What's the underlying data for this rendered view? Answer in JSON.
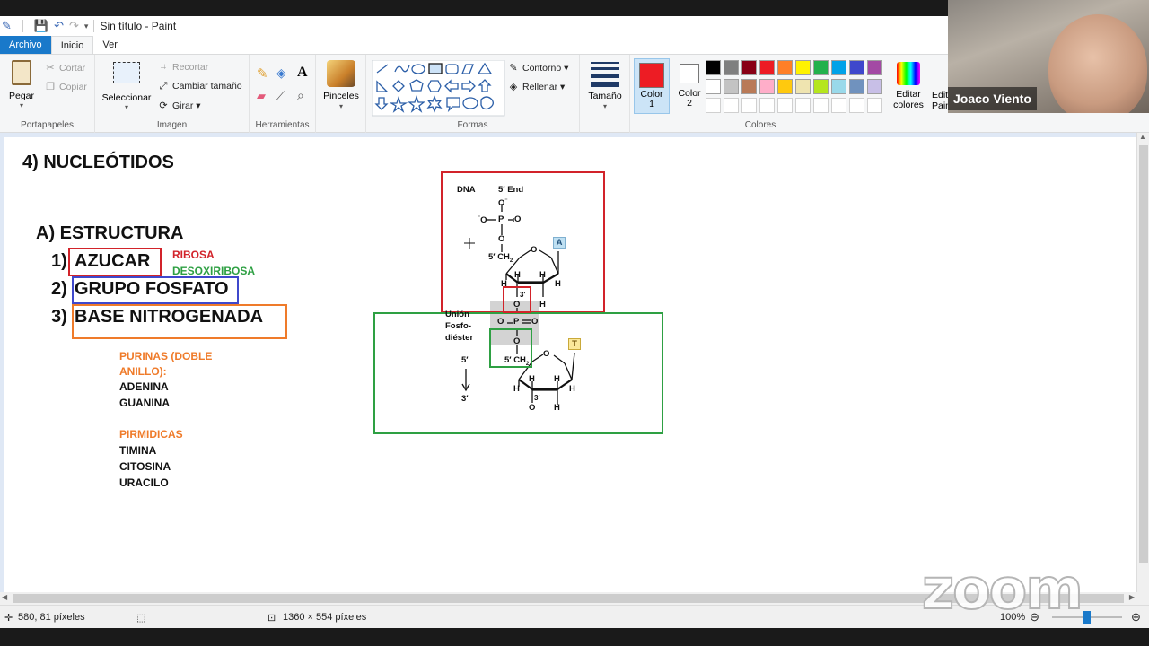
{
  "app": {
    "title": "Sin título - Paint"
  },
  "ribbon_tabs": [
    "Archivo",
    "Inicio",
    "Ver"
  ],
  "groups": {
    "portapapeles": {
      "label": "Portapapeles",
      "paste": "Pegar",
      "cut": "Cortar",
      "copy": "Copiar"
    },
    "imagen": {
      "label": "Imagen",
      "select": "Seleccionar",
      "crop": "Recortar",
      "resize": "Cambiar tamaño",
      "rotate": "Girar"
    },
    "herramientas": {
      "label": "Herramientas"
    },
    "pinceles": {
      "label": "Pinceles"
    },
    "formas": {
      "label": "Formas",
      "outline": "Contorno",
      "fill": "Rellenar"
    },
    "tamano": {
      "label": "Tamaño"
    },
    "colores": {
      "label": "Colores",
      "color1": "Color 1",
      "color2": "Color 2",
      "edit": "Editar colores",
      "edit3d": "Editar con Paint 3D",
      "color1_value": "#ed1c24",
      "color2_value": "#ffffff",
      "palette_row1": [
        "#000000",
        "#7f7f7f",
        "#880015",
        "#ed1c24",
        "#ff7f27",
        "#fff200",
        "#22b14c",
        "#00a2e8",
        "#3f48cc",
        "#a349a4"
      ],
      "palette_row2": [
        "#ffffff",
        "#c3c3c3",
        "#b97a57",
        "#ffaec9",
        "#ffc90e",
        "#efe4b0",
        "#b5e61d",
        "#99d9ea",
        "#7092be",
        "#c8bfe7"
      ]
    }
  },
  "canvas": {
    "heading": "4) NUCLEÓTIDOS",
    "subheading": "A) ESTRUCTURA",
    "items": [
      {
        "num": "1)",
        "text": "AZUCAR"
      },
      {
        "num": "2)",
        "text": "GRUPO FOSFATO"
      },
      {
        "num": "3)",
        "text": "BASE NITROGENADA"
      }
    ],
    "sugar_types": {
      "ribosa": "RIBOSA",
      "desoxiribosa": "DESOXIRIBOSA"
    },
    "purinas_title": "PURINAS (DOBLE ANILLO):",
    "purinas": [
      "ADENINA",
      "GUANINA"
    ],
    "pirimidicas_title": "PIRMIDICAS",
    "pirimidicas": [
      "TIMINA",
      "CITOSINA",
      "URACILO"
    ],
    "diagram": {
      "dna": "DNA",
      "end5": "5′ End",
      "union": "Unión",
      "fosfo": "Fosfo-",
      "diester": "diéster",
      "base_a": "A",
      "base_t": "T",
      "dir_5": "5′",
      "dir_3": "3′"
    }
  },
  "status": {
    "coords": "580, 81 píxeles",
    "size": "1360 × 554 píxeles",
    "zoom": "100%"
  },
  "overlay": {
    "participant": "Joaco Viento",
    "logo": "zoom"
  }
}
